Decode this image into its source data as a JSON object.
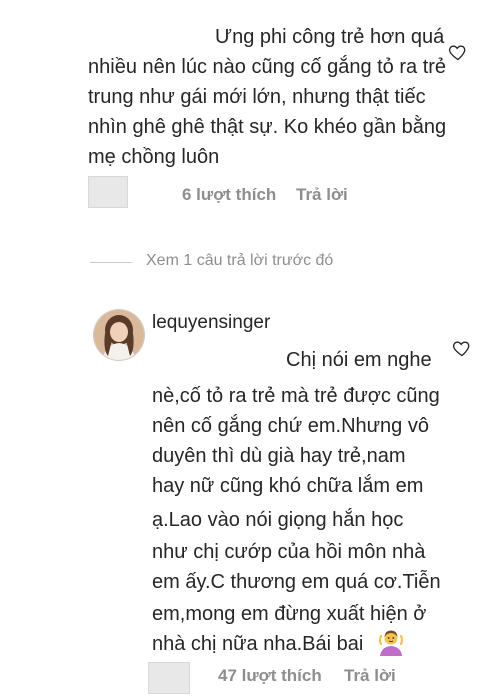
{
  "comment1": {
    "lines": [
      "Ưng phi công trẻ hơn quá",
      "nhiều nên lúc nào cũng cố gắng tỏ ra trẻ",
      "trung như gái mới lớn, nhưng thật tiếc",
      "nhìn ghê ghê thật sự. Ko khéo gần bằng",
      "mẹ chồng luôn"
    ],
    "likes": "6 lượt thích",
    "reply": "Trả lời"
  },
  "view_replies": "Xem 1 câu trả lời trước đó",
  "comment2": {
    "username": "lequyensinger",
    "lines": [
      "Chị nói em nghe",
      "nè,cố tỏ ra trẻ mà trẻ được cũng",
      "nên cố gắng chứ em.Nhưng vô",
      "duyên thì dù già hay trẻ,nam",
      "hay nữ cũng khó chữa lắm em",
      "ạ.Lao vào nói giọng hắn học",
      "như chị cướp của hồi môn nhà",
      "em ấy.C thương em quá cơ.Tiễn",
      "em,mong em đừng xuất hiện ở",
      "nhà chị nữa nha.Bái bai"
    ],
    "likes": "47 lượt thích",
    "reply": "Trả lời"
  },
  "icons": {
    "like1": "heart-outline",
    "like2": "heart-outline",
    "emoji": "person-shrugging-emoji"
  }
}
